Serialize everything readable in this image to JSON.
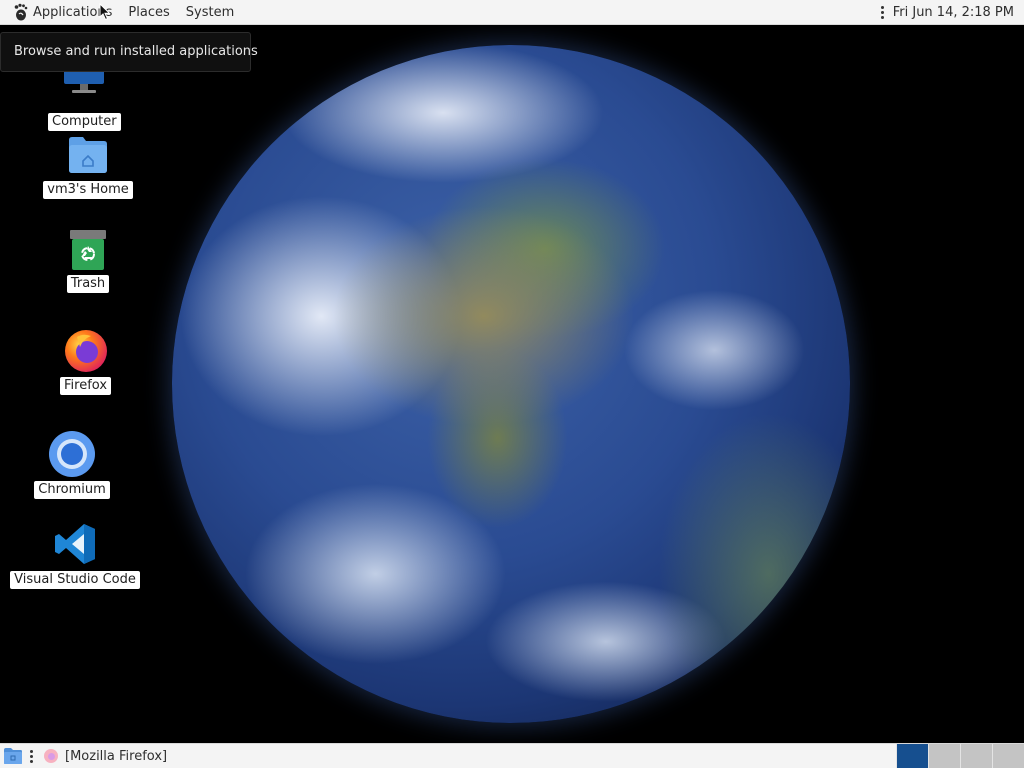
{
  "top_panel": {
    "menus": [
      {
        "label": "Applications",
        "icon": "gnome-foot-icon"
      },
      {
        "label": "Places"
      },
      {
        "label": "System"
      }
    ],
    "clock": "Fri Jun 14,  2:18 PM"
  },
  "tooltip": {
    "text": "Browse and run installed applications"
  },
  "desktop": {
    "icons": [
      {
        "label": "Computer",
        "icon": "computer-icon"
      },
      {
        "label": "vm3's Home",
        "icon": "home-folder-icon"
      },
      {
        "label": "Trash",
        "icon": "trash-icon"
      },
      {
        "label": "Firefox",
        "icon": "firefox-icon"
      },
      {
        "label": "Chromium",
        "icon": "chromium-icon"
      },
      {
        "label": "Visual Studio Code",
        "icon": "vscode-icon"
      }
    ]
  },
  "bottom_panel": {
    "task": {
      "label": "[Mozilla Firefox]",
      "icon": "firefox-icon"
    },
    "workspaces": [
      {
        "name": "workspace-1",
        "active": true
      },
      {
        "name": "workspace-2",
        "active": false
      },
      {
        "name": "workspace-3",
        "active": false
      },
      {
        "name": "workspace-4",
        "active": false
      }
    ]
  },
  "colors": {
    "panel": "#f4f4f4",
    "active_workspace": "#164f8f",
    "inactive_workspace": "#c4c4c4"
  }
}
